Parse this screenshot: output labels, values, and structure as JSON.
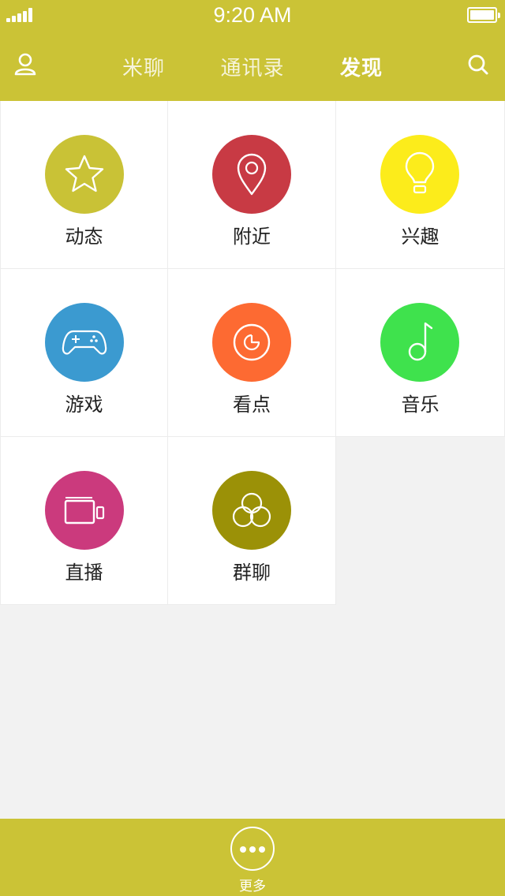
{
  "status": {
    "time": "9:20 AM"
  },
  "nav": {
    "tabs": [
      {
        "label": "米聊"
      },
      {
        "label": "通讯录"
      },
      {
        "label": "发现"
      }
    ],
    "active_tab": "发现",
    "left_icon": "user-icon",
    "right_icon": "search-icon"
  },
  "features": [
    {
      "label": "动态",
      "icon": "star-icon",
      "color": "#c9c236"
    },
    {
      "label": "附近",
      "icon": "location-pin-icon",
      "color": "#c83a44"
    },
    {
      "label": "兴趣",
      "icon": "lightbulb-icon",
      "color": "#fcec1b"
    },
    {
      "label": "游戏",
      "icon": "gamepad-icon",
      "color": "#3b9ad0"
    },
    {
      "label": "看点",
      "icon": "pie-chart-icon",
      "color": "#fd6a32"
    },
    {
      "label": "音乐",
      "icon": "music-note-icon",
      "color": "#3fe24d"
    },
    {
      "label": "直播",
      "icon": "video-camera-icon",
      "color": "#cb3a7d"
    },
    {
      "label": "群聊",
      "icon": "group-circles-icon",
      "color": "#9b9107"
    }
  ],
  "bottom": {
    "more_label": "更多",
    "more_icon": "more-dots-icon"
  },
  "colors": {
    "brand": "#cbc336",
    "background": "#f2f2f2"
  }
}
